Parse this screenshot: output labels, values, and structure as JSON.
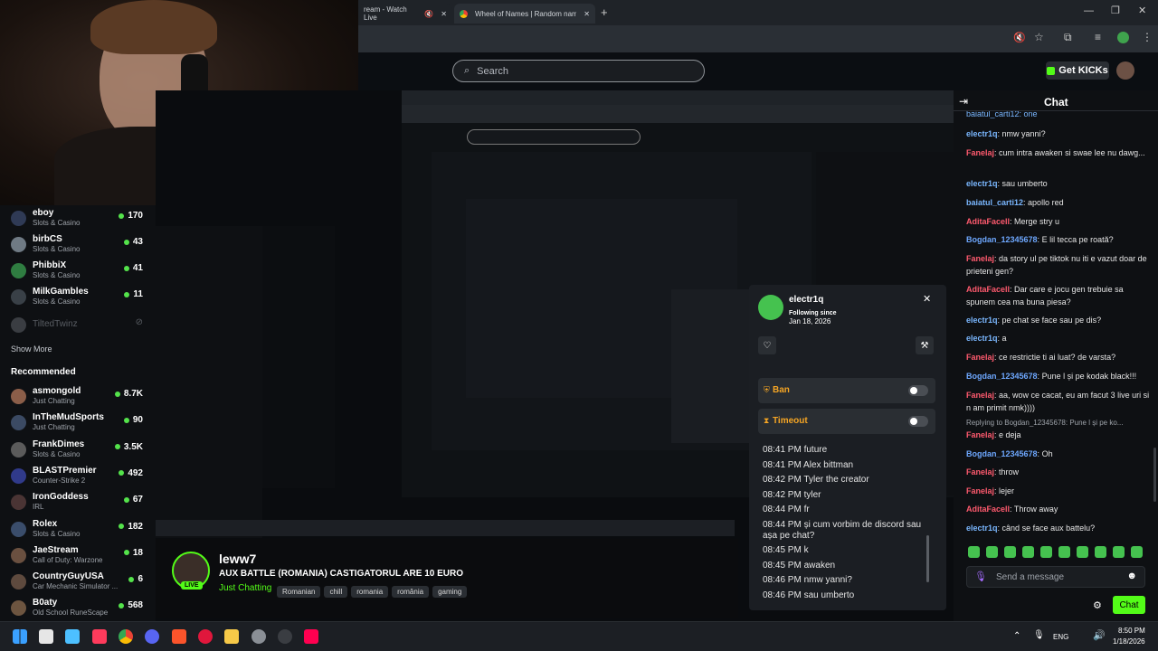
{
  "browser": {
    "tab1_title": "ream - Watch Live",
    "tab2_title": "Wheel of Names | Random nam"
  },
  "header": {
    "search_placeholder": "Search",
    "get_kicks": "Get KICKs"
  },
  "sidebar": {
    "channels": [
      {
        "name": "eboy",
        "category": "Slots & Casino",
        "viewers": "170",
        "color": "#2f3a55"
      },
      {
        "name": "birbCS",
        "category": "Slots & Casino",
        "viewers": "43",
        "color": "#6f7a84"
      },
      {
        "name": "PhibbiX",
        "category": "Slots & Casino",
        "viewers": "41",
        "color": "#2f7d41"
      },
      {
        "name": "MilkGambles",
        "category": "Slots & Casino",
        "viewers": "11",
        "color": "#394047"
      }
    ],
    "offline_channel": "TiltedTwinz",
    "show_more": "Show More",
    "recommended_heading": "Recommended",
    "recommended": [
      {
        "name": "asmongold",
        "category": "Just Chatting",
        "viewers": "8.7K",
        "color": "#8b5e49"
      },
      {
        "name": "InTheMudSports",
        "category": "Just Chatting",
        "viewers": "90",
        "color": "#3b4a63"
      },
      {
        "name": "FrankDimes",
        "category": "Slots & Casino",
        "viewers": "3.5K",
        "color": "#5b5b5b"
      },
      {
        "name": "BLASTPremier",
        "category": "Counter-Strike 2",
        "viewers": "492",
        "color": "#303a8a"
      },
      {
        "name": "IronGoddess",
        "category": "IRL",
        "viewers": "67",
        "color": "#4a3434"
      },
      {
        "name": "Rolex",
        "category": "Slots & Casino",
        "viewers": "182",
        "color": "#3a4d6b"
      },
      {
        "name": "JaeStream",
        "category": "Call of Duty: Warzone",
        "viewers": "18",
        "color": "#6a5040"
      },
      {
        "name": "CountryGuyUSA",
        "category": "Car Mechanic Simulator ...",
        "viewers": "6",
        "color": "#5e4a3e"
      },
      {
        "name": "B0aty",
        "category": "Old School RuneScape",
        "viewers": "568",
        "color": "#6d5540"
      }
    ]
  },
  "stream": {
    "streamer": "leww7",
    "title": "AUX BATTLE (ROMANIA) CASTIGATORUL ARE 10 EURO",
    "category": "Just Chatting",
    "tags": [
      "Romanian",
      "chill",
      "romania",
      "românia",
      "gaming"
    ],
    "live_label": "LIVE"
  },
  "user_card": {
    "username": "electr1q",
    "following_label": "Following since",
    "following_date": "Jan 18, 2026",
    "ban_label": "Ban",
    "timeout_label": "Timeout",
    "history": [
      {
        "time": "08:41 PM",
        "text": "future"
      },
      {
        "time": "08:41 PM",
        "text": "Alex bittman"
      },
      {
        "time": "08:42 PM",
        "text": "Tyler the creator"
      },
      {
        "time": "08:42 PM",
        "text": "tyler"
      },
      {
        "time": "08:44 PM",
        "text": "fr"
      },
      {
        "time": "08:44 PM",
        "text": "și cum vorbim de discord sau așa pe chat?"
      },
      {
        "time": "08:45 PM",
        "text": "k"
      },
      {
        "time": "08:45 PM",
        "text": "awaken"
      },
      {
        "time": "08:46 PM",
        "text": "nmw yanni?"
      },
      {
        "time": "08:46 PM",
        "text": "sau umberto"
      }
    ]
  },
  "chat": {
    "title": "Chat",
    "top_partial": "baiatul_carti12: one",
    "messages": [
      {
        "user": "electr1q",
        "color": "#7ab7ff",
        "text": "nmw yanni?"
      },
      {
        "user": "Fanelaj",
        "color": "#ff5a6e",
        "text": "cum intra awaken si swae lee nu dawg..."
      },
      {
        "user": "electr1q",
        "color": "#7ab7ff",
        "text": "sau umberto"
      },
      {
        "user": "baiatul_carti12",
        "color": "#7ab7ff",
        "text": "apollo red"
      },
      {
        "user": "AditaFacell",
        "color": "#ff5a6e",
        "text": "Merge stry u"
      },
      {
        "user": "Bogdan_12345678",
        "color": "#6ea8ff",
        "text": "E lil tecca pe roată?"
      },
      {
        "user": "Fanelaj",
        "color": "#ff5a6e",
        "text": "da story ul pe tiktok nu iti e vazut doar de prieteni gen?"
      },
      {
        "user": "AditaFacell",
        "color": "#ff5a6e",
        "text": "Dar care e jocu gen trebuie sa spunem cea ma buna piesa?"
      },
      {
        "user": "electr1q",
        "color": "#7ab7ff",
        "text": "pe chat se face sau pe dis?"
      },
      {
        "user": "electr1q",
        "color": "#7ab7ff",
        "text": "a"
      },
      {
        "user": "Fanelaj",
        "color": "#ff5a6e",
        "text": "ce restrictie ti ai luat? de varsta?"
      },
      {
        "user": "Bogdan_12345678",
        "color": "#6ea8ff",
        "text": "Pune l și pe kodak black!!!"
      },
      {
        "user": "Fanelaj",
        "color": "#ff5a6e",
        "text": "aa, wow ce cacat, eu am facut 3 live uri si n am primit nmk))))"
      },
      {
        "user": "Fanelaj",
        "color": "#ff5a6e",
        "text": "e deja"
      },
      {
        "user": "Bogdan_12345678",
        "color": "#6ea8ff",
        "text": "Oh"
      },
      {
        "user": "Fanelaj",
        "color": "#ff5a6e",
        "text": "throw"
      },
      {
        "user": "Fanelaj",
        "color": "#ff5a6e",
        "text": "lejer"
      },
      {
        "user": "AditaFacell",
        "color": "#ff5a6e",
        "text": "Throw away"
      },
      {
        "user": "electr1q",
        "color": "#7ab7ff",
        "text": "când se face aux battelu?"
      }
    ],
    "reply_hint": "Replying to Bogdan_12345678: Pune l și pe ko...",
    "input_placeholder": "Send a message",
    "send_button": "Chat"
  },
  "taskbar": {
    "language": "ENG",
    "time": "8:50 PM",
    "date": "1/18/2026"
  },
  "colors": {
    "accent": "#53fc18",
    "background": "#0b0c0e",
    "panel": "#0e1013"
  }
}
